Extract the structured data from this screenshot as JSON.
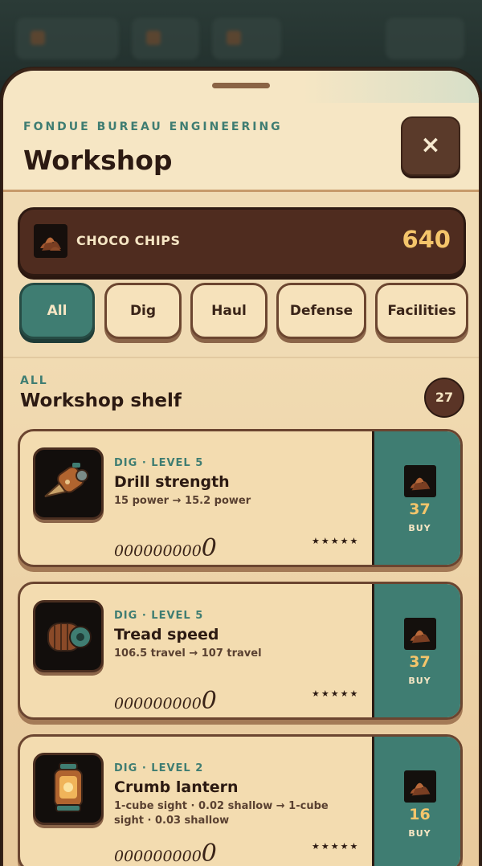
{
  "header": {
    "eyebrow": "FONDUE BUREAU ENGINEERING",
    "title": "Workshop",
    "close_icon": "×"
  },
  "currency": {
    "icon": "choco-chips-icon",
    "label": "CHOCO CHIPS",
    "value": "640"
  },
  "tabs": [
    {
      "label": "All",
      "active": true
    },
    {
      "label": "Dig",
      "active": false
    },
    {
      "label": "Haul",
      "active": false
    },
    {
      "label": "Defense",
      "active": false
    },
    {
      "label": "Facilities",
      "active": false
    }
  ],
  "section": {
    "label": "ALL",
    "title": "Workshop shelf",
    "count": "27"
  },
  "items": [
    {
      "icon": "drill-icon",
      "category": "DIG · LEVEL 5",
      "name": "Drill strength",
      "description": "15 power → 15.2 power",
      "pips": "000000000",
      "pip_last": "0",
      "stars": "★★★★★",
      "price": "37",
      "buy_label": "BUY"
    },
    {
      "icon": "tread-icon",
      "category": "DIG · LEVEL 5",
      "name": "Tread speed",
      "description": "106.5 travel → 107 travel",
      "pips": "000000000",
      "pip_last": "0",
      "stars": "★★★★★",
      "price": "37",
      "buy_label": "BUY"
    },
    {
      "icon": "lantern-icon",
      "category": "DIG · LEVEL 2",
      "name": "Crumb lantern",
      "description": "1-cube sight · 0.02 shallow → 1-cube sight · 0.03 shallow",
      "pips": "000000000",
      "pip_last": "0",
      "stars": "★★★★★",
      "price": "16",
      "buy_label": "BUY"
    }
  ],
  "colors": {
    "accent_teal": "#3f7d72",
    "dark_brown": "#4f2c1f",
    "cream": "#f6e6c4",
    "gold": "#f4c56b"
  }
}
